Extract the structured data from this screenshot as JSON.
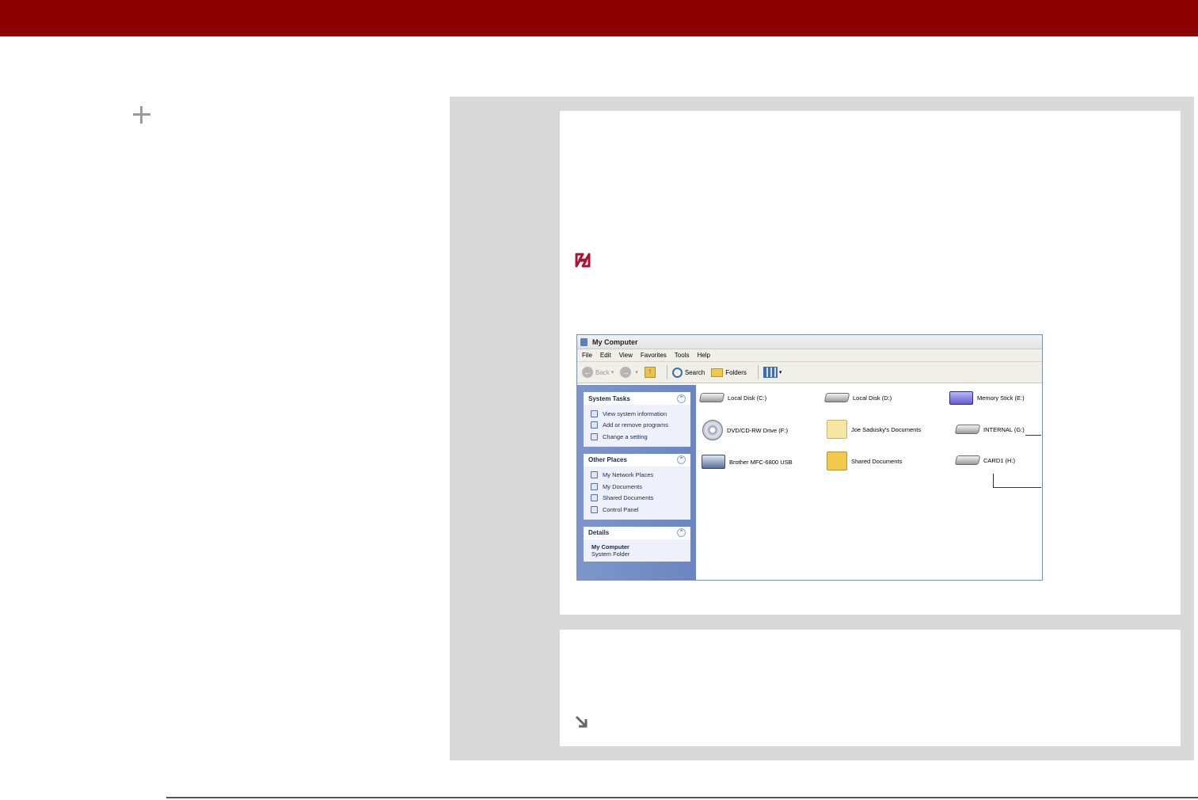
{
  "header": {
    "bar_color": "#8b0000"
  },
  "sidebar": {
    "icon": "plus-icon"
  },
  "step1": {
    "note_icon": "palm-note-icon"
  },
  "step2": {
    "icon": "arrow-down-right-icon"
  },
  "window": {
    "title": "My Computer",
    "menu": [
      "File",
      "Edit",
      "View",
      "Favorites",
      "Tools",
      "Help"
    ],
    "toolbar": {
      "back": "Back",
      "search": "Search",
      "folders": "Folders"
    },
    "system_tasks": {
      "title": "System Tasks",
      "items": [
        "View system information",
        "Add or remove programs",
        "Change a setting"
      ]
    },
    "other_places": {
      "title": "Other Places",
      "items": [
        "My Network Places",
        "My Documents",
        "Shared Documents",
        "Control Panel"
      ]
    },
    "details": {
      "title": "Details",
      "name": "My Computer",
      "type": "System Folder"
    },
    "drives": [
      {
        "label": "Local Disk (C:)",
        "icon": "hard-disk-icon"
      },
      {
        "label": "Local Disk (D:)",
        "icon": "hard-disk-icon"
      },
      {
        "label": "Memory Stick (E:)",
        "icon": "memory-stick-icon"
      },
      {
        "label": "DVD/CD-RW Drive (F:)",
        "icon": "cd-drive-icon"
      },
      {
        "label": "Joe Sadusky's Documents",
        "icon": "folder-icon"
      },
      {
        "label": "INTERNAL (G:)",
        "icon": "removable-drive-icon"
      },
      {
        "label": "Brother MFC-6800 USB",
        "icon": "scanner-icon"
      },
      {
        "label": "Shared Documents",
        "icon": "shared-folder-icon"
      },
      {
        "label": "CARD1 (H:)",
        "icon": "removable-drive-icon"
      }
    ]
  }
}
